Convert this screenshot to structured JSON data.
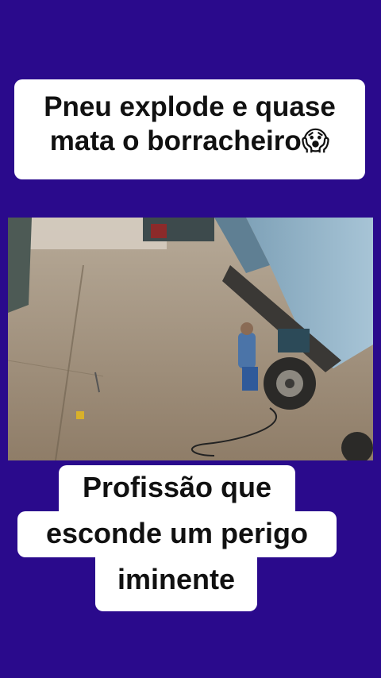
{
  "top_caption": {
    "line1": "Pneu explode e quase",
    "line2": "mata o borracheiro",
    "emoji": "😱",
    "emoji_name": "scream-face-emoji"
  },
  "bottom_caption": {
    "line1": "Profissão que",
    "line2": "esconde um perigo",
    "line3": "iminente"
  },
  "colors": {
    "background": "#2a0a8c",
    "caption_box": "#ffffff",
    "caption_text": "#111111"
  },
  "video": {
    "description_icon": "security-camera-footage"
  }
}
